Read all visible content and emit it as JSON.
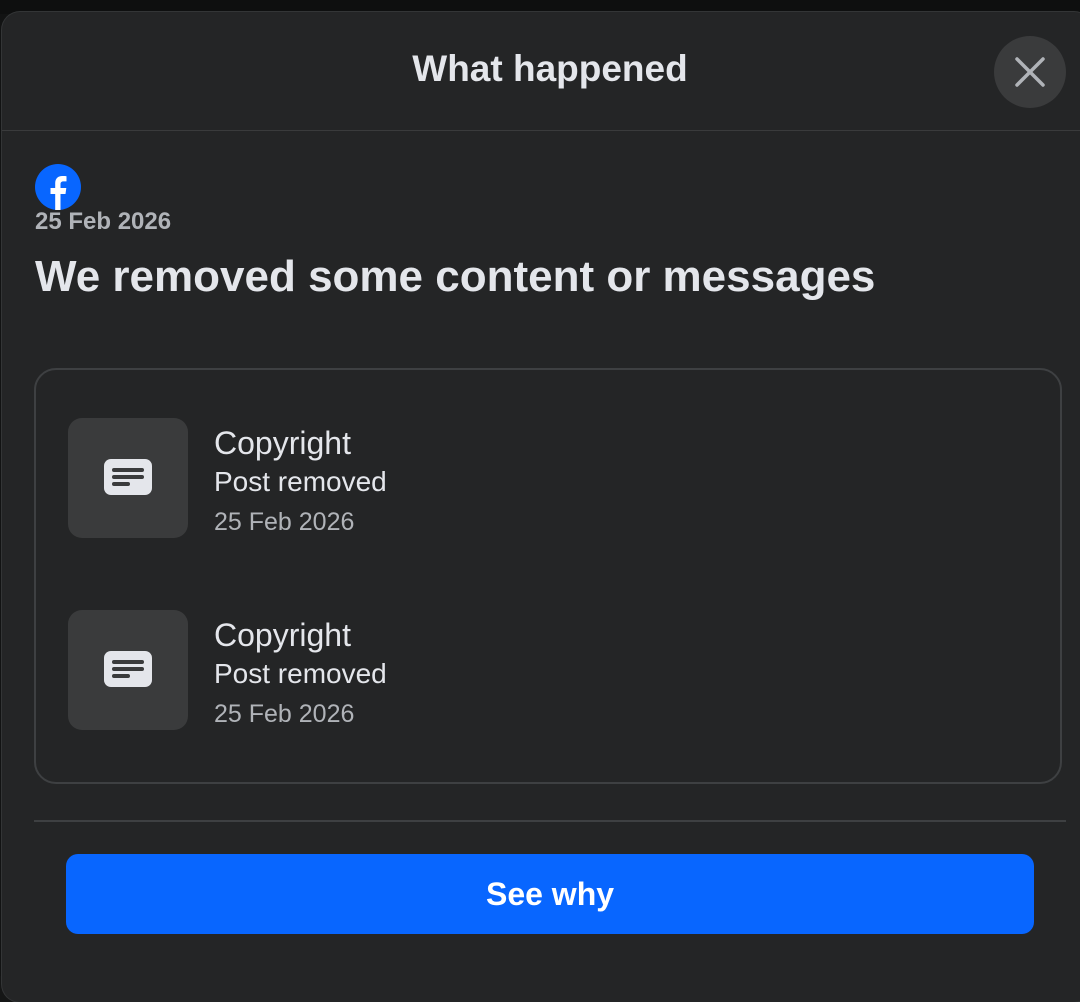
{
  "modal": {
    "title": "What happened",
    "close_icon": "close-icon"
  },
  "notice": {
    "platform_icon": "facebook-logo-icon",
    "date": "25 Feb 2026",
    "heading": "We removed some content or messages"
  },
  "items": [
    {
      "icon": "post-text-icon",
      "title": "Copyright",
      "status": "Post removed",
      "date": "25 Feb 2026"
    },
    {
      "icon": "post-text-icon",
      "title": "Copyright",
      "status": "Post removed",
      "date": "25 Feb 2026"
    }
  ],
  "actions": {
    "primary_label": "See why"
  },
  "colors": {
    "modal_bg": "#242526",
    "accent": "#0866ff",
    "text_primary": "#e4e6eb",
    "text_secondary": "#b0b3b8"
  }
}
